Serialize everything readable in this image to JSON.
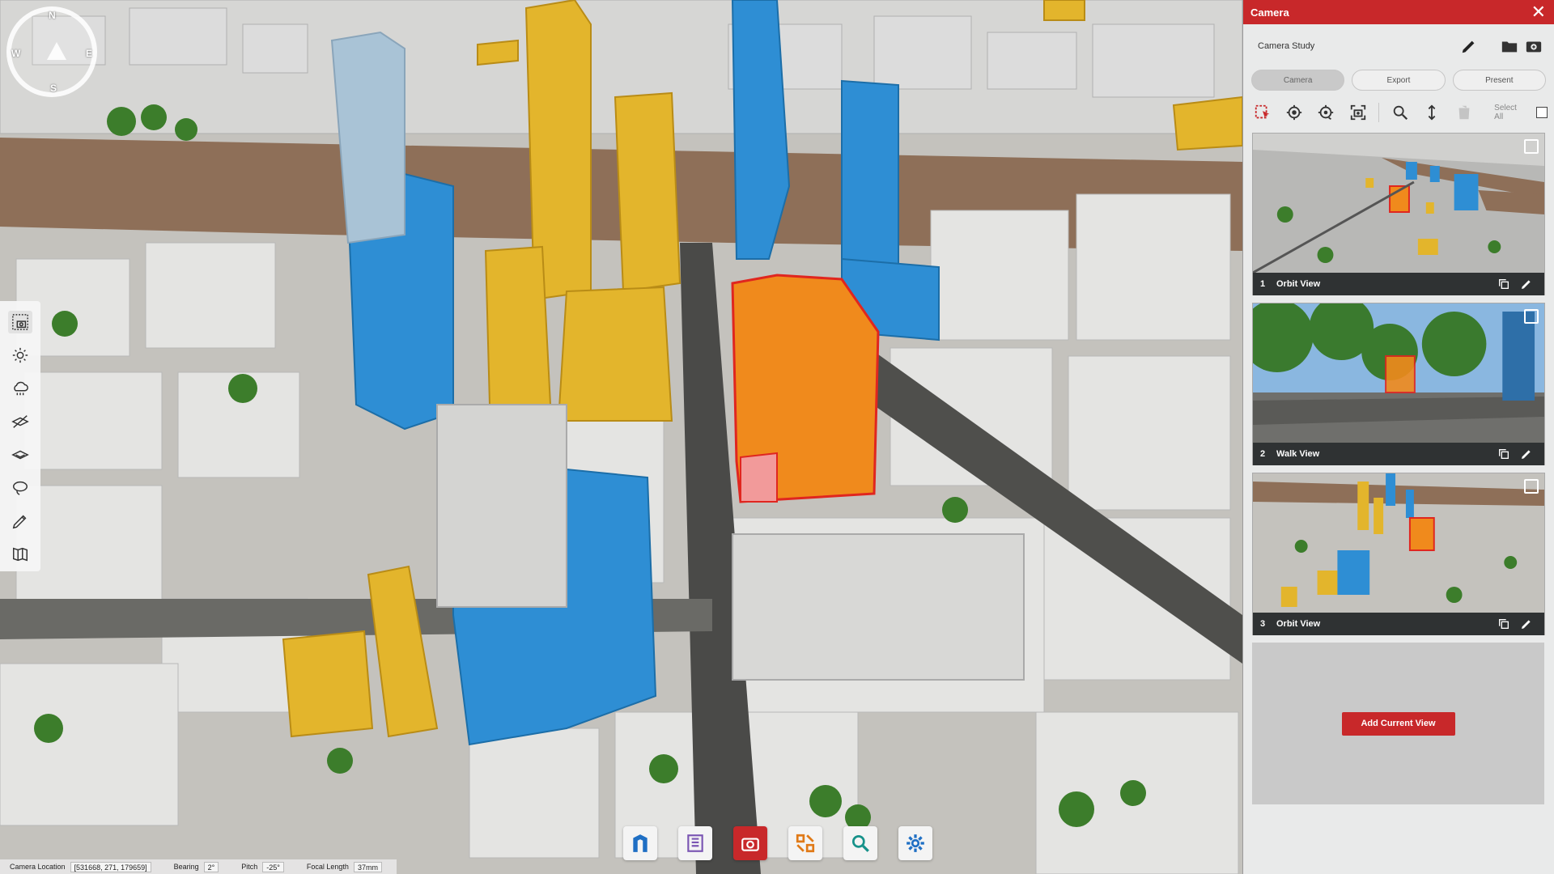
{
  "compass": {
    "n": "N",
    "s": "S",
    "e": "E",
    "w": "W"
  },
  "left_tools": [
    "camera-tool-icon",
    "sun-icon",
    "weather-icon",
    "hide-layer-icon",
    "layers-icon",
    "lasso-icon",
    "draw-icon",
    "map-icon"
  ],
  "bottom_tools": [
    "site-icon",
    "documents-icon",
    "camera-icon",
    "planning-icon",
    "search-icon",
    "settings-icon"
  ],
  "status": {
    "camera_location_label": "Camera Location",
    "camera_location_value": "[531668, 271, 179659]",
    "bearing_label": "Bearing",
    "bearing_value": "2°",
    "pitch_label": "Pitch",
    "pitch_value": "-25°",
    "focal_length_label": "Focal Length",
    "focal_length_value": "37mm"
  },
  "panel": {
    "title": "Camera",
    "close": "✕",
    "study_name": "Camera Study",
    "tabs": [
      {
        "label": "Camera",
        "active": true
      },
      {
        "label": "Export",
        "active": false
      },
      {
        "label": "Present",
        "active": false
      }
    ],
    "select_all": "Select All",
    "views": [
      {
        "num": "1",
        "name": "Orbit View"
      },
      {
        "num": "2",
        "name": "Walk View"
      },
      {
        "num": "3",
        "name": "Orbit View"
      }
    ],
    "add_button": "Add Current View"
  },
  "colors": {
    "accent_red": "#c8282a",
    "building_blue": "#2e8ed4",
    "building_yellow": "#e3b52c",
    "building_orange": "#f08a1c",
    "river": "#8e6f58"
  }
}
